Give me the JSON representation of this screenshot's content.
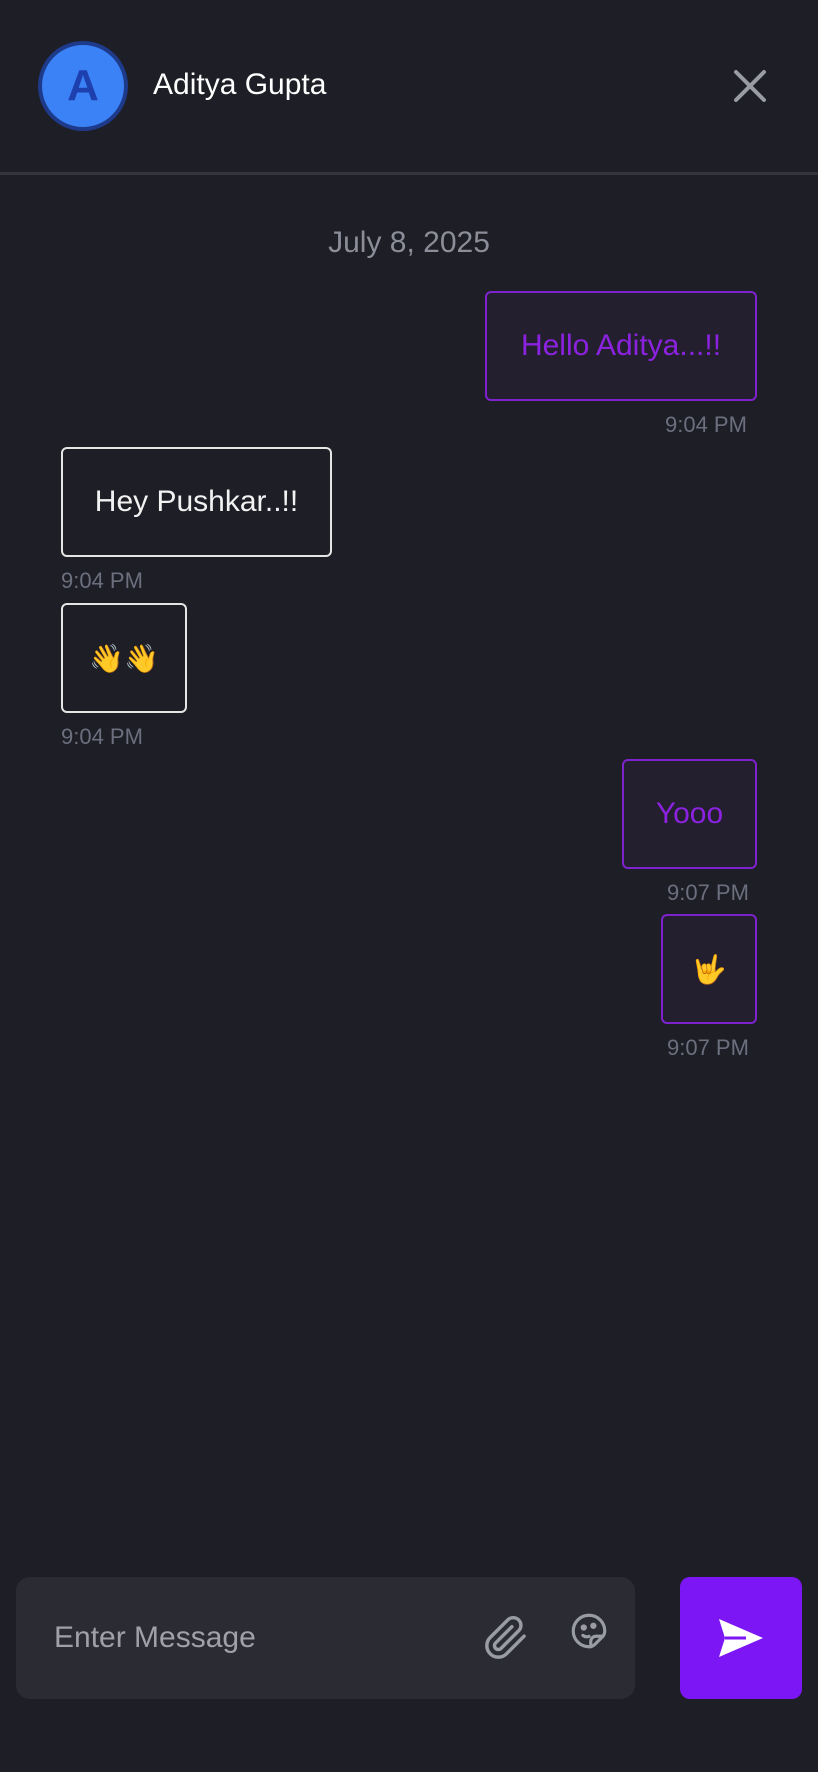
{
  "header": {
    "avatar_letter": "A",
    "contact_name": "Aditya Gupta"
  },
  "conversation": {
    "date": "July 8, 2025",
    "messages": [
      {
        "direction": "sent",
        "text": "Hello Aditya...!!",
        "time": "9:04 PM"
      },
      {
        "direction": "received",
        "text": "Hey Pushkar..!!",
        "time": "9:04 PM"
      },
      {
        "direction": "received",
        "text": "👋👋",
        "time": "9:04 PM"
      },
      {
        "direction": "sent",
        "text": "Yooo",
        "time": "9:07 PM"
      },
      {
        "direction": "sent",
        "text": "🤟",
        "time": "9:07 PM"
      }
    ]
  },
  "composer": {
    "placeholder": "Enter Message",
    "value": ""
  },
  "icons": {
    "close": "close-icon",
    "attach": "paperclip-icon",
    "emoji": "emoji-sticker-icon",
    "send": "send-icon"
  },
  "colors": {
    "background": "#1e1e26",
    "accent": "#7c16f5",
    "sent_text": "#8b22e0",
    "avatar": "#3b82f6"
  }
}
